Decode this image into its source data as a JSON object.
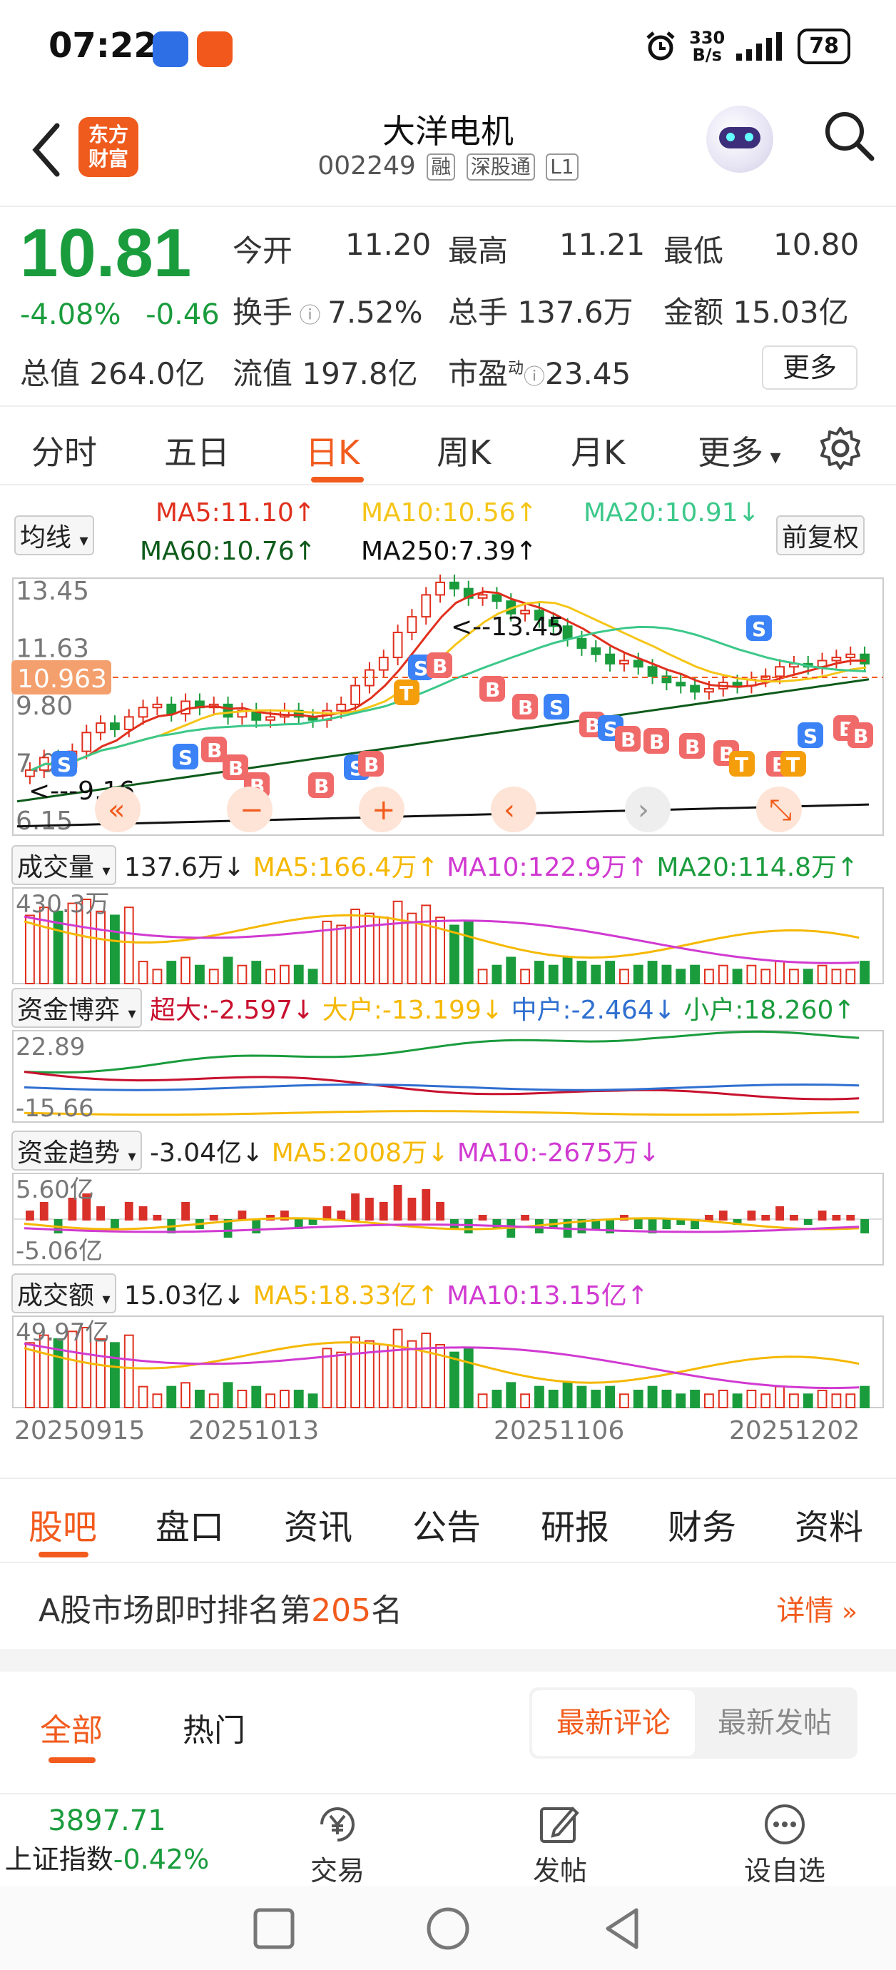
{
  "status_bar": {
    "time": "07:22",
    "net_speed_value": "330",
    "net_speed_unit": "B/s",
    "battery": "78"
  },
  "header": {
    "logo_line1": "东方",
    "logo_line2": "财富",
    "stock_name": "大洋电机",
    "stock_code": "002249",
    "tags": [
      "融",
      "深股通",
      "L1"
    ]
  },
  "quote": {
    "price": "10.81",
    "change_pct": "-4.08%",
    "change_abs": "-0.46",
    "open_label": "今开",
    "open": "11.20",
    "high_label": "最高",
    "high": "11.21",
    "low_label": "最低",
    "low": "10.80",
    "turnover_label": "换手",
    "turnover": "7.52%",
    "volume_label": "总手",
    "volume": "137.6万",
    "amount_label": "金额",
    "amount": "15.03亿",
    "mktcap_label": "总值",
    "mktcap": "264.0亿",
    "float_label": "流值",
    "float": "197.8亿",
    "pe_label": "市盈",
    "pe_sup": "动",
    "pe": "23.45",
    "more_btn": "更多"
  },
  "period_tabs": [
    "分时",
    "五日",
    "日K",
    "周K",
    "月K",
    "更多"
  ],
  "main_chart": {
    "indicator_dropdown": "均线",
    "ma5": "MA5:11.10↑",
    "ma10": "MA10:10.56↑",
    "ma20": "MA20:10.91↓",
    "ma60": "MA60:10.76↑",
    "ma250": "MA250:7.39↑",
    "adjust_btn": "前复权",
    "y_labels": [
      "13.45",
      "11.63",
      "9.80",
      "7.98",
      "6.15"
    ],
    "current_price_tag": "10.963",
    "high_mark": "13.45",
    "low_mark": "9.16"
  },
  "volume_panel": {
    "dropdown": "成交量",
    "value": "137.6万↓",
    "ma5": "MA5:166.4万↑",
    "ma10": "MA10:122.9万↑",
    "ma20": "MA20:114.8万↑",
    "y_max": "430.3万"
  },
  "fund_game_panel": {
    "dropdown": "资金博弈",
    "super": "超大:-2.597↓",
    "large": "大户:-13.199↓",
    "mid": "中户:-2.464↓",
    "small": "小户:18.260↑",
    "y_max": "22.89",
    "y_min": "-15.66"
  },
  "fund_trend_panel": {
    "dropdown": "资金趋势",
    "value": "-3.04亿↓",
    "ma5": "MA5:2008万↓",
    "ma10": "MA10:-2675万↓",
    "y_max": "5.60亿",
    "y_min": "-5.06亿"
  },
  "amount_panel": {
    "dropdown": "成交额",
    "value": "15.03亿↓",
    "ma5": "MA5:18.33亿↑",
    "ma10": "MA10:13.15亿↑",
    "y_max": "49.97亿"
  },
  "x_dates": [
    "20250915",
    "20251013",
    "20251106",
    "20251202"
  ],
  "info_tabs": [
    "股吧",
    "盘口",
    "资讯",
    "公告",
    "研报",
    "财务",
    "资料"
  ],
  "rank": {
    "prefix": "A股市场即时排名第",
    "number": "205",
    "suffix": "名",
    "detail_link": "详情"
  },
  "comment_tabs": {
    "all": "全部",
    "hot": "热门",
    "latest_comment": "最新评论",
    "latest_post": "最新发帖"
  },
  "bottom_nav": {
    "index_value": "3897.71",
    "index_name": "上证指数",
    "index_change": "-0.42%",
    "trade": "交易",
    "post": "发帖",
    "watch": "设自选"
  },
  "colors": {
    "up": "#e0301e",
    "down": "#1a9c3d",
    "accent": "#f25b1d"
  }
}
